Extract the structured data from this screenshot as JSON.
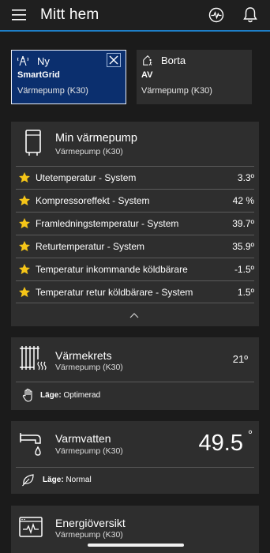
{
  "header": {
    "title": "Mitt hem",
    "menu_icon": "menu-icon",
    "pulse_icon": "pulse-icon",
    "bell_icon": "bell-icon",
    "accent": "#1e7fc8"
  },
  "modes": [
    {
      "title": "Ny",
      "bold": "SmartGrid",
      "sub": "Värmepump (K30)",
      "icon": "tower-icon",
      "active": true
    },
    {
      "title": "Borta",
      "bold": "AV",
      "sub": "Värmepump (K30)",
      "icon": "house-leave-icon",
      "active": false
    }
  ],
  "heatpump": {
    "title": "Min värmepump",
    "subtitle": "Värmepump (K30)",
    "rows": [
      {
        "label": "Utetemperatur - System",
        "value": "3.3º"
      },
      {
        "label": "Kompressoreffekt - System",
        "value": "42 %"
      },
      {
        "label": "Framledningstemperatur - System",
        "value": "39.7º"
      },
      {
        "label": "Returtemperatur - System",
        "value": "35.9º"
      },
      {
        "label": "Temperatur inkommande köldbärare",
        "value": "-1.5º"
      },
      {
        "label": "Temperatur retur köldbärare - System",
        "value": "1.5º"
      }
    ],
    "star_color": "#f5c518"
  },
  "heating_circuit": {
    "title": "Värmekrets",
    "subtitle": "Värmepump (K30)",
    "temp": "21º",
    "mode_label": "Läge:",
    "mode_value": "Optimerad"
  },
  "hot_water": {
    "title": "Varmvatten",
    "subtitle": "Värmepump (K30)",
    "temp": "49.5",
    "degree": "°",
    "mode_label": "Läge:",
    "mode_value": "Normal"
  },
  "energy": {
    "title": "Energiöversikt",
    "subtitle": "Värmepump (K30)"
  }
}
